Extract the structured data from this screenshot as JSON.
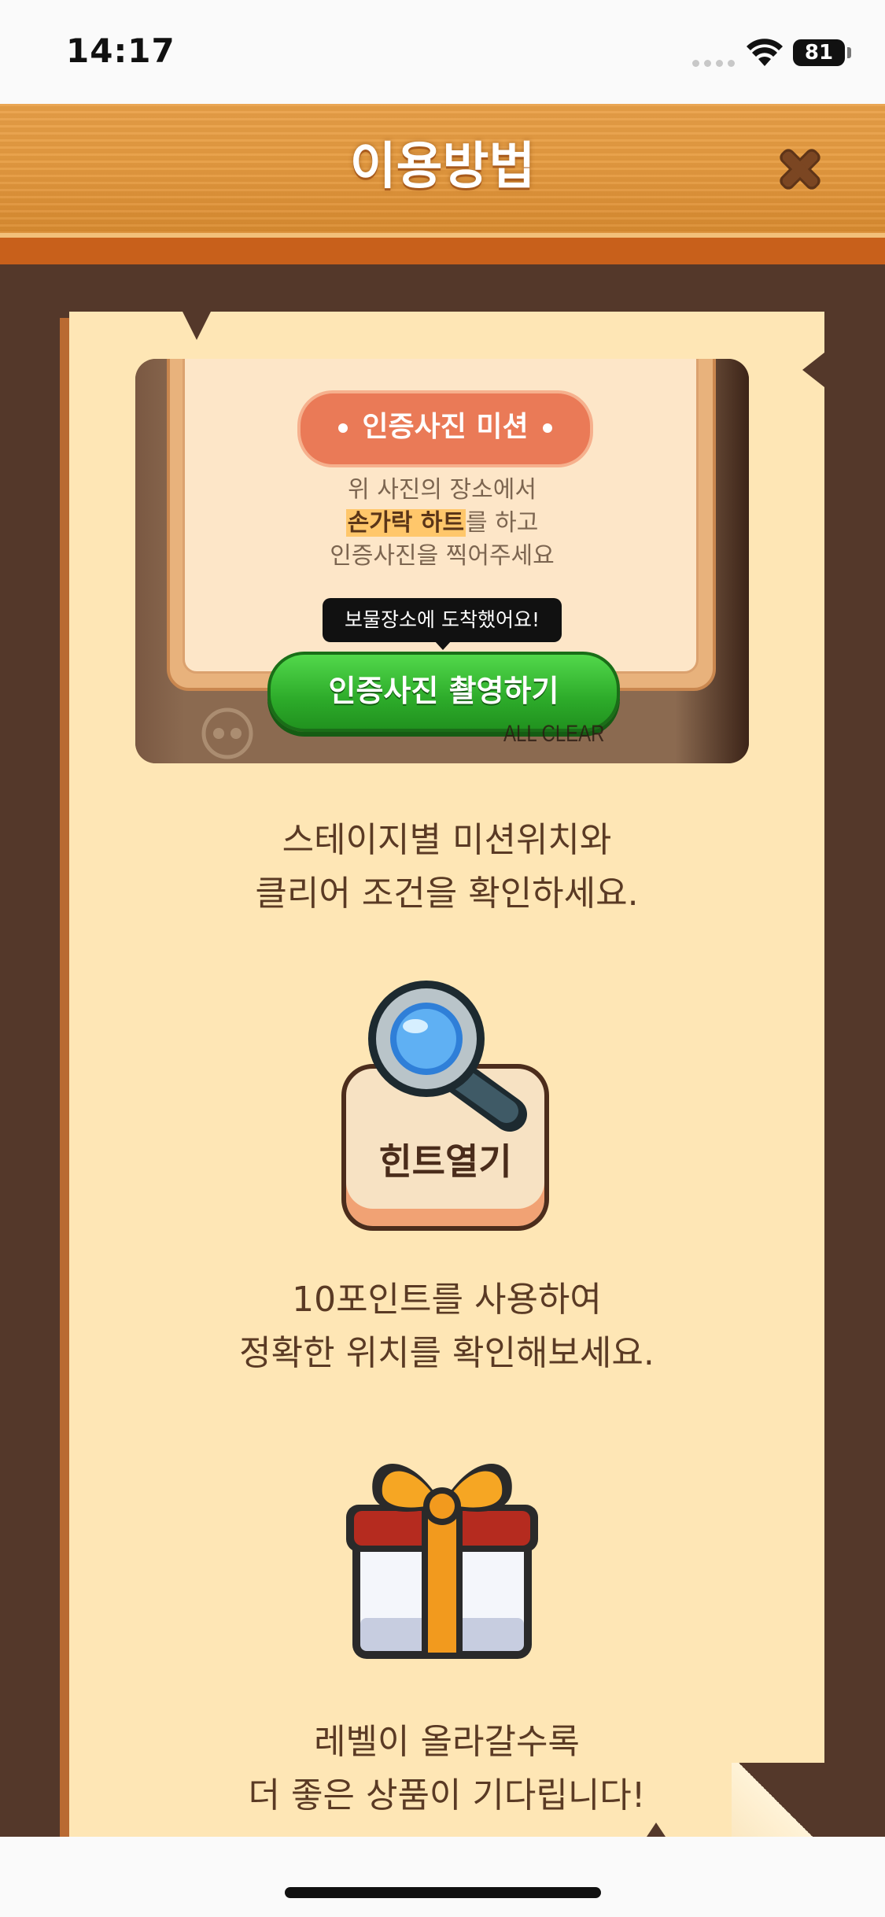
{
  "status_bar": {
    "time": "14:17",
    "battery": "81"
  },
  "header": {
    "title": "이용방법"
  },
  "card": {
    "mission_label": "인증사진 미션",
    "line1": "위 사진의 장소에서",
    "highlight": "손가락 하트",
    "line2_rest": "를 하고",
    "line3": "인증사진을 찍어주세요",
    "tooltip": "보물장소에 도착했어요!",
    "button": "인증사진 촬영하기",
    "watermark": "ALL CLEAR"
  },
  "sections": [
    {
      "line1": "스테이지별 미션위치와",
      "line2": "클리어 조건을 확인하세요."
    },
    {
      "icon_label": "힌트열기",
      "line1": "10포인트를 사용하여",
      "line2": "정확한 위치를 확인해보세요."
    },
    {
      "line1": "레벨이 올라갈수록",
      "line2": "더 좋은 상품이 기다립니다!"
    }
  ],
  "colors": {
    "header": "#e69b40",
    "paper": "#fee6b5",
    "frame": "#54382a",
    "text": "#5a3a24",
    "green_button": "#2dab2a",
    "mission_pill": "#ea7a57"
  }
}
